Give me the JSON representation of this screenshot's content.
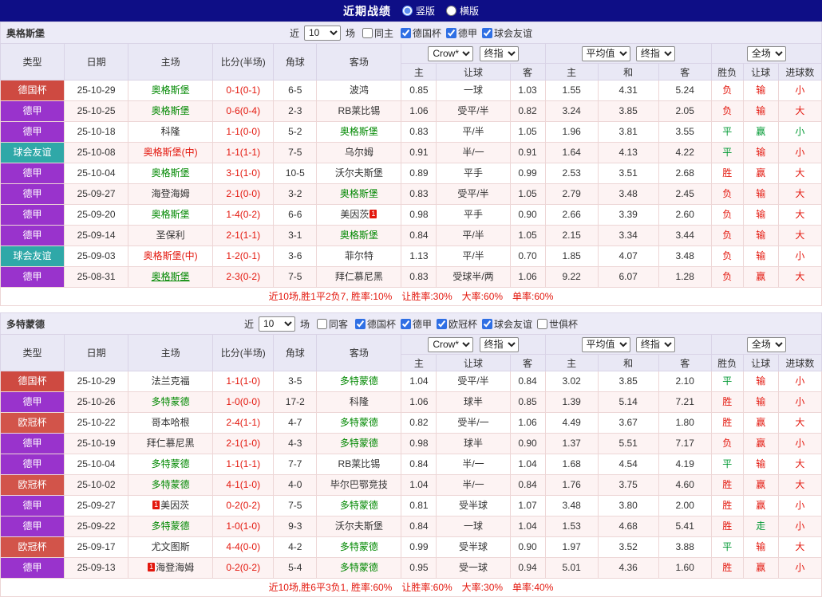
{
  "colors": {
    "score": "#E3170D",
    "team": {
      "g": "#008800",
      "k": "#333333",
      "r": "#E3170D"
    },
    "types": {
      "德国杯": "#CE4A41",
      "德甲": "#9933CC",
      "球会友谊": "#2FA8A8",
      "欧冠杯": "#D2544A"
    },
    "res": {
      "r": "#E3170D",
      "g": "#009933"
    }
  },
  "titlebar": {
    "title": "近期战绩",
    "options": [
      {
        "label": "竖版",
        "selected": true
      },
      {
        "label": "横版",
        "selected": false
      }
    ]
  },
  "header": {
    "cols": [
      "类型",
      "日期",
      "主场",
      "比分(半场)",
      "角球",
      "客场"
    ],
    "odds_select1": "Crow*",
    "odds_select2": "终指",
    "avg_select1": "平均值",
    "avg_select2": "终指",
    "full_select": "全场",
    "sub": [
      "主",
      "让球",
      "客",
      "主",
      "和",
      "客",
      "胜负",
      "让球",
      "进球数"
    ]
  },
  "sections": [
    {
      "team": "奥格斯堡",
      "filter": {
        "near": "近",
        "count": "10",
        "unit": "场",
        "same": {
          "label": "同主",
          "checked": false
        },
        "comps": [
          {
            "label": "德国杯",
            "checked": true
          },
          {
            "label": "德甲",
            "checked": true
          },
          {
            "label": "球会友谊",
            "checked": true
          }
        ]
      },
      "rows": [
        {
          "type": "德国杯",
          "date": "25-10-29",
          "home": {
            "n": "奥格斯堡",
            "c": "g"
          },
          "score": "0-1(0-1)",
          "corner": "6-5",
          "away": {
            "n": "波鸿",
            "c": "k"
          },
          "odds": [
            "0.85",
            "一球",
            "1.03"
          ],
          "avg": [
            "1.55",
            "4.31",
            "5.24"
          ],
          "res": [
            [
              "负",
              "r"
            ],
            [
              "输",
              "r"
            ],
            [
              "小",
              "r"
            ]
          ]
        },
        {
          "type": "德甲",
          "date": "25-10-25",
          "home": {
            "n": "奥格斯堡",
            "c": "g"
          },
          "score": "0-6(0-4)",
          "corner": "2-3",
          "away": {
            "n": "RB莱比锡",
            "c": "k"
          },
          "odds": [
            "1.06",
            "受平/半",
            "0.82"
          ],
          "avg": [
            "3.24",
            "3.85",
            "2.05"
          ],
          "res": [
            [
              "负",
              "r"
            ],
            [
              "输",
              "r"
            ],
            [
              "大",
              "r"
            ]
          ]
        },
        {
          "type": "德甲",
          "date": "25-10-18",
          "home": {
            "n": "科隆",
            "c": "k"
          },
          "score": "1-1(0-0)",
          "corner": "5-2",
          "away": {
            "n": "奥格斯堡",
            "c": "g"
          },
          "odds": [
            "0.83",
            "平/半",
            "1.05"
          ],
          "avg": [
            "1.96",
            "3.81",
            "3.55"
          ],
          "res": [
            [
              "平",
              "g"
            ],
            [
              "赢",
              "g"
            ],
            [
              "小",
              "g"
            ]
          ]
        },
        {
          "type": "球会友谊",
          "date": "25-10-08",
          "home": {
            "n": "奥格斯堡(中)",
            "c": "r"
          },
          "score": "1-1(1-1)",
          "corner": "7-5",
          "away": {
            "n": "乌尔姆",
            "c": "k"
          },
          "odds": [
            "0.91",
            "半/一",
            "0.91"
          ],
          "avg": [
            "1.64",
            "4.13",
            "4.22"
          ],
          "res": [
            [
              "平",
              "g"
            ],
            [
              "输",
              "r"
            ],
            [
              "小",
              "r"
            ]
          ]
        },
        {
          "type": "德甲",
          "date": "25-10-04",
          "home": {
            "n": "奥格斯堡",
            "c": "g"
          },
          "score": "3-1(1-0)",
          "corner": "10-5",
          "away": {
            "n": "沃尔夫斯堡",
            "c": "k"
          },
          "odds": [
            "0.89",
            "平手",
            "0.99"
          ],
          "avg": [
            "2.53",
            "3.51",
            "2.68"
          ],
          "res": [
            [
              "胜",
              "r"
            ],
            [
              "赢",
              "r"
            ],
            [
              "大",
              "r"
            ]
          ]
        },
        {
          "type": "德甲",
          "date": "25-09-27",
          "home": {
            "n": "海登海姆",
            "c": "k"
          },
          "score": "2-1(0-0)",
          "corner": "3-2",
          "away": {
            "n": "奥格斯堡",
            "c": "g"
          },
          "odds": [
            "0.83",
            "受平/半",
            "1.05"
          ],
          "avg": [
            "2.79",
            "3.48",
            "2.45"
          ],
          "res": [
            [
              "负",
              "r"
            ],
            [
              "输",
              "r"
            ],
            [
              "大",
              "r"
            ]
          ]
        },
        {
          "type": "德甲",
          "date": "25-09-20",
          "home": {
            "n": "奥格斯堡",
            "c": "g"
          },
          "score": "1-4(0-2)",
          "corner": "6-6",
          "away": {
            "n": "美因茨",
            "c": "k",
            "badge": "1",
            "badge_pos": "after"
          },
          "odds": [
            "0.98",
            "平手",
            "0.90"
          ],
          "avg": [
            "2.66",
            "3.39",
            "2.60"
          ],
          "res": [
            [
              "负",
              "r"
            ],
            [
              "输",
              "r"
            ],
            [
              "大",
              "r"
            ]
          ]
        },
        {
          "type": "德甲",
          "date": "25-09-14",
          "home": {
            "n": "圣保利",
            "c": "k"
          },
          "score": "2-1(1-1)",
          "corner": "3-1",
          "away": {
            "n": "奥格斯堡",
            "c": "g"
          },
          "odds": [
            "0.84",
            "平/半",
            "1.05"
          ],
          "avg": [
            "2.15",
            "3.34",
            "3.44"
          ],
          "res": [
            [
              "负",
              "r"
            ],
            [
              "输",
              "r"
            ],
            [
              "大",
              "r"
            ]
          ]
        },
        {
          "type": "球会友谊",
          "date": "25-09-03",
          "home": {
            "n": "奥格斯堡(中)",
            "c": "r"
          },
          "score": "1-2(0-1)",
          "corner": "3-6",
          "away": {
            "n": "菲尔特",
            "c": "k"
          },
          "odds": [
            "1.13",
            "平/半",
            "0.70"
          ],
          "avg": [
            "1.85",
            "4.07",
            "3.48"
          ],
          "res": [
            [
              "负",
              "r"
            ],
            [
              "输",
              "r"
            ],
            [
              "小",
              "r"
            ]
          ]
        },
        {
          "type": "德甲",
          "date": "25-08-31",
          "home": {
            "n": "奥格斯堡",
            "c": "g",
            "u": true
          },
          "score": "2-3(0-2)",
          "corner": "7-5",
          "away": {
            "n": "拜仁慕尼黑",
            "c": "k"
          },
          "odds": [
            "0.83",
            "受球半/两",
            "1.06"
          ],
          "avg": [
            "9.22",
            "6.07",
            "1.28"
          ],
          "res": [
            [
              "负",
              "r"
            ],
            [
              "赢",
              "r"
            ],
            [
              "大",
              "r"
            ]
          ]
        }
      ],
      "summary": "近10场,胜1平2负7, 胜率:10%　让胜率:30%　大率:60%　单率:60%"
    },
    {
      "team": "多特蒙德",
      "filter": {
        "near": "近",
        "count": "10",
        "unit": "场",
        "same": {
          "label": "同客",
          "checked": false
        },
        "comps": [
          {
            "label": "德国杯",
            "checked": true
          },
          {
            "label": "德甲",
            "checked": true
          },
          {
            "label": "欧冠杯",
            "checked": true
          },
          {
            "label": "球会友谊",
            "checked": true
          },
          {
            "label": "世俱杯",
            "checked": false
          }
        ]
      },
      "rows": [
        {
          "type": "德国杯",
          "date": "25-10-29",
          "home": {
            "n": "法兰克福",
            "c": "k"
          },
          "score": "1-1(1-0)",
          "corner": "3-5",
          "away": {
            "n": "多特蒙德",
            "c": "g"
          },
          "odds": [
            "1.04",
            "受平/半",
            "0.84"
          ],
          "avg": [
            "3.02",
            "3.85",
            "2.10"
          ],
          "res": [
            [
              "平",
              "g"
            ],
            [
              "输",
              "r"
            ],
            [
              "小",
              "r"
            ]
          ]
        },
        {
          "type": "德甲",
          "date": "25-10-26",
          "home": {
            "n": "多特蒙德",
            "c": "g"
          },
          "score": "1-0(0-0)",
          "corner": "17-2",
          "away": {
            "n": "科隆",
            "c": "k"
          },
          "odds": [
            "1.06",
            "球半",
            "0.85"
          ],
          "avg": [
            "1.39",
            "5.14",
            "7.21"
          ],
          "res": [
            [
              "胜",
              "r"
            ],
            [
              "输",
              "r"
            ],
            [
              "小",
              "r"
            ]
          ]
        },
        {
          "type": "欧冠杯",
          "date": "25-10-22",
          "home": {
            "n": "哥本哈根",
            "c": "k"
          },
          "score": "2-4(1-1)",
          "corner": "4-7",
          "away": {
            "n": "多特蒙德",
            "c": "g"
          },
          "odds": [
            "0.82",
            "受半/一",
            "1.06"
          ],
          "avg": [
            "4.49",
            "3.67",
            "1.80"
          ],
          "res": [
            [
              "胜",
              "r"
            ],
            [
              "赢",
              "r"
            ],
            [
              "大",
              "r"
            ]
          ]
        },
        {
          "type": "德甲",
          "date": "25-10-19",
          "home": {
            "n": "拜仁慕尼黑",
            "c": "k"
          },
          "score": "2-1(1-0)",
          "corner": "4-3",
          "away": {
            "n": "多特蒙德",
            "c": "g"
          },
          "odds": [
            "0.98",
            "球半",
            "0.90"
          ],
          "avg": [
            "1.37",
            "5.51",
            "7.17"
          ],
          "res": [
            [
              "负",
              "r"
            ],
            [
              "赢",
              "r"
            ],
            [
              "小",
              "r"
            ]
          ]
        },
        {
          "type": "德甲",
          "date": "25-10-04",
          "home": {
            "n": "多特蒙德",
            "c": "g"
          },
          "score": "1-1(1-1)",
          "corner": "7-7",
          "away": {
            "n": "RB莱比锡",
            "c": "k"
          },
          "odds": [
            "0.84",
            "半/一",
            "1.04"
          ],
          "avg": [
            "1.68",
            "4.54",
            "4.19"
          ],
          "res": [
            [
              "平",
              "g"
            ],
            [
              "输",
              "r"
            ],
            [
              "大",
              "r"
            ]
          ]
        },
        {
          "type": "欧冠杯",
          "date": "25-10-02",
          "home": {
            "n": "多特蒙德",
            "c": "g"
          },
          "score": "4-1(1-0)",
          "corner": "4-0",
          "away": {
            "n": "毕尔巴鄂竞技",
            "c": "k"
          },
          "odds": [
            "1.04",
            "半/一",
            "0.84"
          ],
          "avg": [
            "1.76",
            "3.75",
            "4.60"
          ],
          "res": [
            [
              "胜",
              "r"
            ],
            [
              "赢",
              "r"
            ],
            [
              "大",
              "r"
            ]
          ]
        },
        {
          "type": "德甲",
          "date": "25-09-27",
          "home": {
            "n": "美因茨",
            "c": "k",
            "badge": "1",
            "badge_pos": "before"
          },
          "score": "0-2(0-2)",
          "corner": "7-5",
          "away": {
            "n": "多特蒙德",
            "c": "g"
          },
          "odds": [
            "0.81",
            "受半球",
            "1.07"
          ],
          "avg": [
            "3.48",
            "3.80",
            "2.00"
          ],
          "res": [
            [
              "胜",
              "r"
            ],
            [
              "赢",
              "r"
            ],
            [
              "小",
              "r"
            ]
          ]
        },
        {
          "type": "德甲",
          "date": "25-09-22",
          "home": {
            "n": "多特蒙德",
            "c": "g"
          },
          "score": "1-0(1-0)",
          "corner": "9-3",
          "away": {
            "n": "沃尔夫斯堡",
            "c": "k"
          },
          "odds": [
            "0.84",
            "一球",
            "1.04"
          ],
          "avg": [
            "1.53",
            "4.68",
            "5.41"
          ],
          "res": [
            [
              "胜",
              "r"
            ],
            [
              "走",
              "g"
            ],
            [
              "小",
              "r"
            ]
          ]
        },
        {
          "type": "欧冠杯",
          "date": "25-09-17",
          "home": {
            "n": "尤文图斯",
            "c": "k"
          },
          "score": "4-4(0-0)",
          "corner": "4-2",
          "away": {
            "n": "多特蒙德",
            "c": "g"
          },
          "odds": [
            "0.99",
            "受半球",
            "0.90"
          ],
          "avg": [
            "1.97",
            "3.52",
            "3.88"
          ],
          "res": [
            [
              "平",
              "g"
            ],
            [
              "输",
              "r"
            ],
            [
              "大",
              "r"
            ]
          ]
        },
        {
          "type": "德甲",
          "date": "25-09-13",
          "home": {
            "n": "海登海姆",
            "c": "k",
            "badge": "1",
            "badge_pos": "before"
          },
          "score": "0-2(0-2)",
          "corner": "5-4",
          "away": {
            "n": "多特蒙德",
            "c": "g"
          },
          "odds": [
            "0.95",
            "受一球",
            "0.94"
          ],
          "avg": [
            "5.01",
            "4.36",
            "1.60"
          ],
          "res": [
            [
              "胜",
              "r"
            ],
            [
              "赢",
              "r"
            ],
            [
              "小",
              "r"
            ]
          ]
        }
      ],
      "summary": "近10场,胜6平3负1, 胜率:60%　让胜率:60%　大率:30%　单率:40%"
    }
  ]
}
